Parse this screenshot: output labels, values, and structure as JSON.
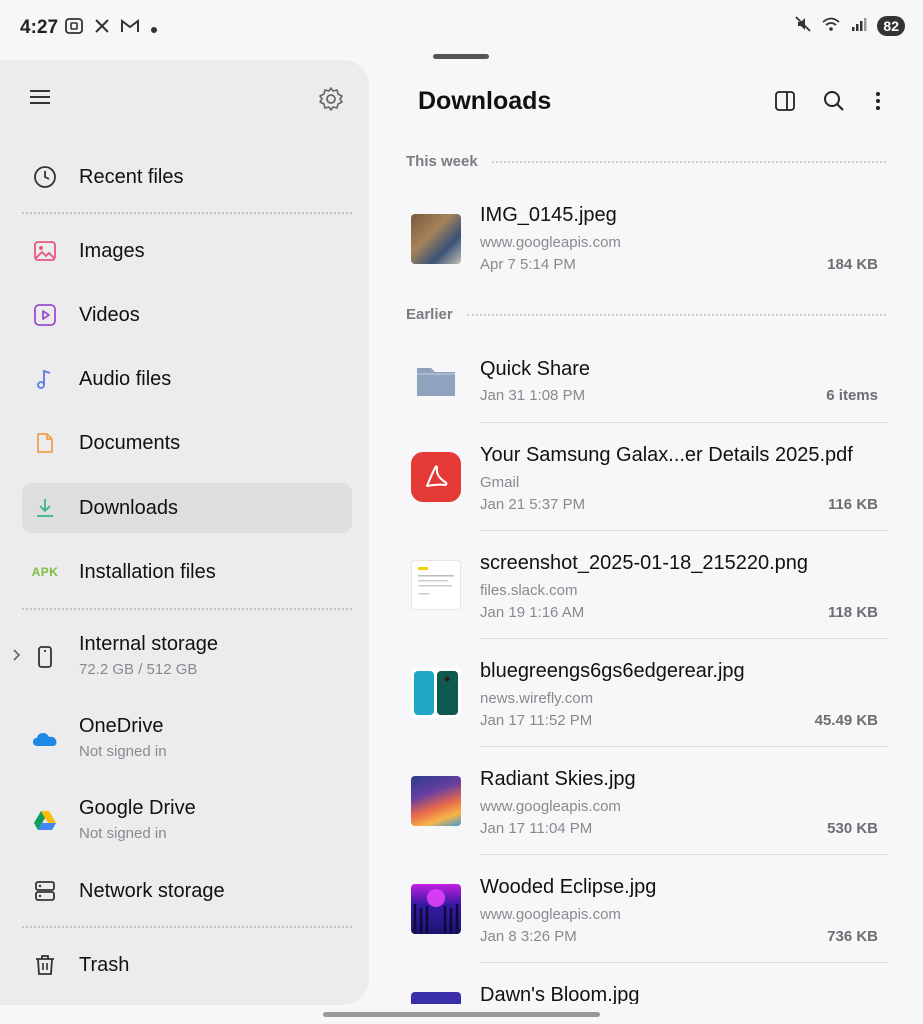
{
  "status_bar": {
    "time": "4:27",
    "left_icons": [
      "screenshot-icon",
      "x-icon",
      "gmail-icon",
      "dot-icon"
    ],
    "battery": "82"
  },
  "sidebar": {
    "items": [
      {
        "label": "Recent files",
        "icon": "clock-icon"
      },
      {
        "label": "Images",
        "icon": "image-icon"
      },
      {
        "label": "Videos",
        "icon": "video-icon"
      },
      {
        "label": "Audio files",
        "icon": "music-note-icon"
      },
      {
        "label": "Documents",
        "icon": "document-icon"
      },
      {
        "label": "Downloads",
        "icon": "download-icon",
        "active": true
      },
      {
        "label": "Installation files",
        "icon": "apk-icon",
        "icon_text": "APK"
      },
      {
        "label": "Internal storage",
        "sub": "72.2 GB / 512 GB",
        "icon": "phone-icon"
      },
      {
        "label": "OneDrive",
        "sub": "Not signed in",
        "icon": "onedrive-icon"
      },
      {
        "label": "Google Drive",
        "sub": "Not signed in",
        "icon": "google-drive-icon"
      },
      {
        "label": "Network storage",
        "icon": "network-storage-icon"
      },
      {
        "label": "Trash",
        "icon": "trash-icon"
      }
    ]
  },
  "main": {
    "title": "Downloads",
    "sections": [
      {
        "label": "This week",
        "files": [
          {
            "name": "IMG_0145.jpeg",
            "source": "www.googleapis.com",
            "date": "Apr 7 5:14 PM",
            "size": "184 KB"
          }
        ]
      },
      {
        "label": "Earlier",
        "files": [
          {
            "name": "Quick Share",
            "source": "",
            "date": "Jan 31 1:08 PM",
            "size": "6 items"
          },
          {
            "name": "Your Samsung Galax...er Details 2025.pdf",
            "source": "Gmail",
            "date": "Jan 21 5:37 PM",
            "size": "116 KB"
          },
          {
            "name": "screenshot_2025-01-18_215220.png",
            "source": "files.slack.com",
            "date": "Jan 19 1:16 AM",
            "size": "118 KB"
          },
          {
            "name": "bluegreengs6gs6edgerear.jpg",
            "source": "news.wirefly.com",
            "date": "Jan 17 11:52 PM",
            "size": "45.49 KB"
          },
          {
            "name": "Radiant Skies.jpg",
            "source": "www.googleapis.com",
            "date": "Jan 17 11:04 PM",
            "size": "530 KB"
          },
          {
            "name": "Wooded Eclipse.jpg",
            "source": "www.googleapis.com",
            "date": "Jan 8 3:26 PM",
            "size": "736 KB"
          },
          {
            "name": "Dawn's Bloom.jpg",
            "source": "",
            "date": "",
            "size": ""
          }
        ]
      }
    ]
  },
  "colors": {
    "accent_download": "#3bb58c",
    "pdf_red": "#e53935",
    "folder": "#8fa3bf"
  }
}
